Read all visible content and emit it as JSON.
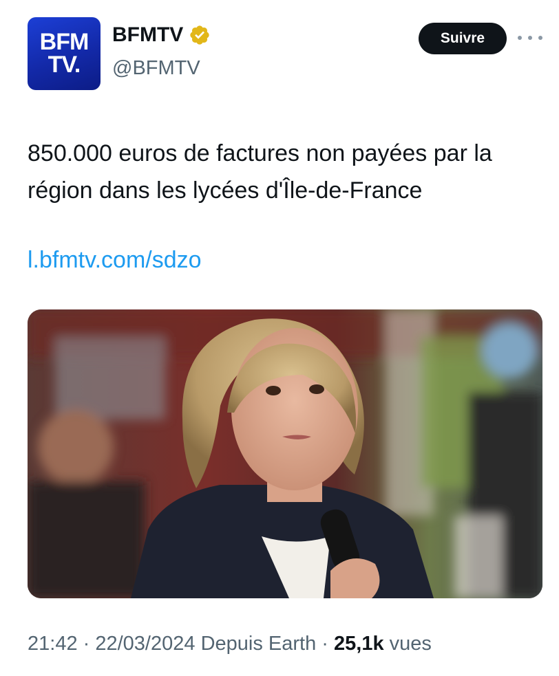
{
  "account": {
    "avatar_line1": "BFM",
    "avatar_line2": "TV.",
    "display_name": "BFMTV",
    "handle": "@BFMTV",
    "verified": true
  },
  "actions": {
    "follow_label": "Suivre"
  },
  "tweet": {
    "text": "850.000 euros de factures non payées par la région dans les lycées d'Île-de-France",
    "link": "l.bfmtv.com/sdzo"
  },
  "meta": {
    "time": "21:42",
    "separator1": " · ",
    "date": "22/03/2024",
    "source": " Depuis Earth",
    "separator2": " · ",
    "views_count": "25,1k",
    "views_label": " vues"
  },
  "colors": {
    "brand_blue": "#1a3bd1",
    "link": "#1d9bf0",
    "verified_gold": "#e2b719",
    "follow_button": "#0f1419",
    "secondary_text": "#536471"
  }
}
